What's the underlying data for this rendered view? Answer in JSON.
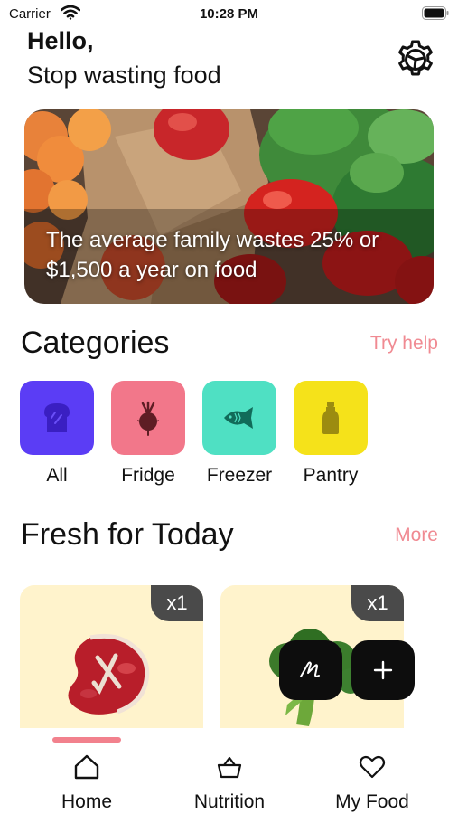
{
  "status_bar": {
    "carrier": "Carrier",
    "time": "10:28 PM"
  },
  "header": {
    "greeting": "Hello,",
    "tagline": "Stop wasting food",
    "settings_icon": "gear-icon"
  },
  "hero": {
    "text": "The average family wastes 25% or $1,500 a year on food"
  },
  "categories_section": {
    "title": "Categories",
    "link": "Try help",
    "items": [
      {
        "label": "All",
        "icon": "bread-icon",
        "color": "#5b3df5"
      },
      {
        "label": "Fridge",
        "icon": "radish-icon",
        "color": "#f2778a"
      },
      {
        "label": "Freezer",
        "icon": "fish-icon",
        "color": "#4fe0c3"
      },
      {
        "label": "Pantry",
        "icon": "bottle-icon",
        "color": "#f5e21a"
      }
    ]
  },
  "fresh_section": {
    "title": "Fresh for Today",
    "link": "More",
    "cards": [
      {
        "name": "steak",
        "quantity": "x1"
      },
      {
        "name": "broccoli",
        "quantity": "x1"
      }
    ]
  },
  "floating_actions": {
    "scan_icon": "scribble-icon",
    "add_icon": "plus-icon"
  },
  "tab_bar": {
    "tabs": [
      {
        "label": "Home",
        "icon": "home-icon",
        "active": true
      },
      {
        "label": "Nutrition",
        "icon": "basket-icon",
        "active": false
      },
      {
        "label": "My Food",
        "icon": "heart-icon",
        "active": false
      }
    ],
    "accent": "#f2818d"
  }
}
